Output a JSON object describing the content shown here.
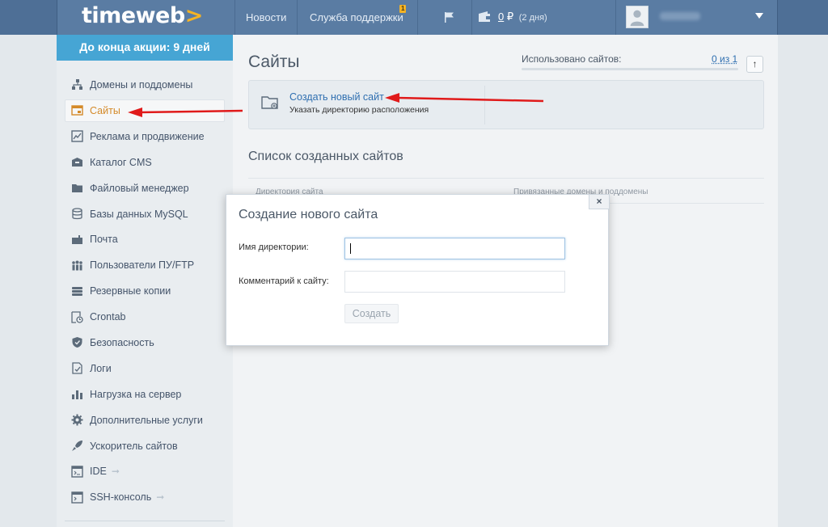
{
  "header": {
    "logo_text": "timeweb",
    "logo_chevron": ">",
    "nav_news": "Новости",
    "nav_support": "Служба поддержки",
    "support_badge": "1",
    "balance_amount": "0",
    "balance_currency": "₽",
    "balance_days": "(2 дня)",
    "dropdown_glyph": "▼"
  },
  "promo": {
    "label": "До конца акции:",
    "days": "9 дней",
    "color": "#46a5d4"
  },
  "sidebar": {
    "items": [
      {
        "label": "Домены и поддомены",
        "icon": "sitemap-icon"
      },
      {
        "label": "Сайты",
        "icon": "site-icon",
        "active": true
      },
      {
        "label": "Реклама и продвижение",
        "icon": "chart-icon"
      },
      {
        "label": "Каталог CMS",
        "icon": "box-icon"
      },
      {
        "label": "Файловый менеджер",
        "icon": "folder-icon"
      },
      {
        "label": "Базы данных MySQL",
        "icon": "database-icon"
      },
      {
        "label": "Почта",
        "icon": "mail-icon"
      },
      {
        "label": "Пользователи ПУ/FTP",
        "icon": "users-icon"
      },
      {
        "label": "Резервные копии",
        "icon": "backup-icon"
      },
      {
        "label": "Crontab",
        "icon": "clock-icon"
      },
      {
        "label": "Безопасность",
        "icon": "shield-icon"
      },
      {
        "label": "Логи",
        "icon": "log-icon"
      },
      {
        "label": "Нагрузка на сервер",
        "icon": "bar-chart-icon"
      },
      {
        "label": "Дополнительные услуги",
        "icon": "gear-icon"
      },
      {
        "label": "Ускоритель сайтов",
        "icon": "rocket-icon"
      },
      {
        "label": "IDE",
        "icon": "ide-icon",
        "external": true
      },
      {
        "label": "SSH-консоль",
        "icon": "terminal-icon",
        "external": true
      }
    ],
    "external_glyph": "➞"
  },
  "main": {
    "title": "Сайты",
    "used_label": "Использовано сайтов:",
    "used_value": "0 из 1",
    "up_glyph": "↑",
    "create_link": "Создать новый сайт",
    "create_sub": "Указать директорию расположения",
    "list_title": "Список созданных сайтов",
    "col_directory": "Директория сайта",
    "col_domains": "Привязанные домены и поддомены"
  },
  "modal": {
    "title": "Создание нового сайта",
    "close_glyph": "×",
    "dir_label": "Имя директории:",
    "dir_value": "",
    "comment_label": "Комментарий к сайту:",
    "comment_value": "",
    "submit_label": "Создать"
  },
  "colors": {
    "header": "#5a7ca3",
    "accent": "#f5b324",
    "active_item": "#d48a29",
    "link": "#2f6fb0",
    "arrow": "#e01a1a"
  }
}
